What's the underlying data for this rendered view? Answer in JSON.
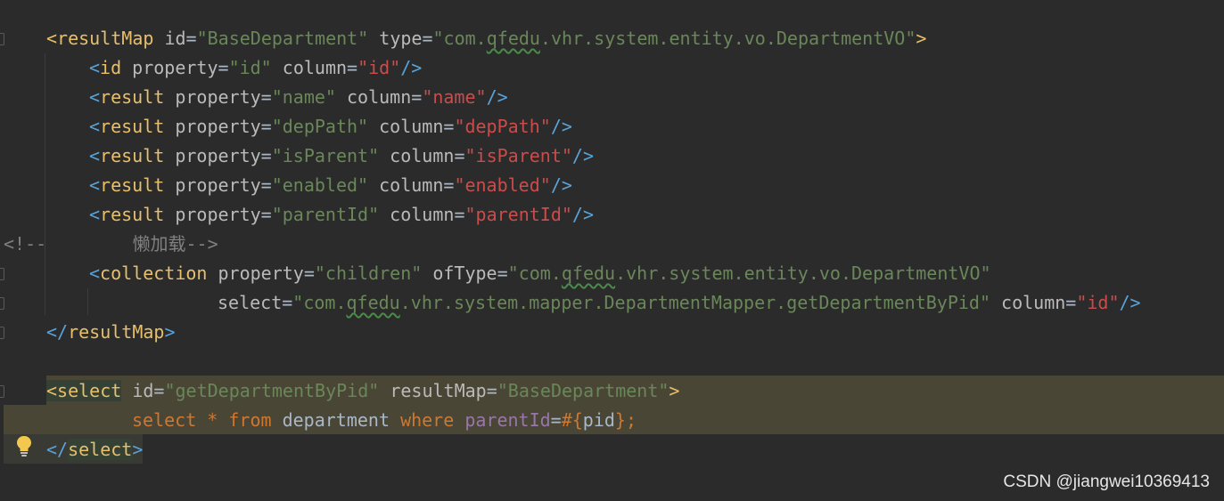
{
  "editor": {
    "lines": [
      {
        "id": "l1",
        "parts": [
          [
            "c-tag",
            "<"
          ],
          [
            "c-tag",
            "resultMap"
          ],
          [
            "c-attr",
            " id"
          ],
          [
            "c-txt",
            "="
          ],
          [
            "c-str",
            "\"BaseDepartment\""
          ],
          [
            "c-attr",
            " type"
          ],
          [
            "c-txt",
            "="
          ],
          [
            "c-str",
            "\"com."
          ],
          [
            "c-str squig",
            "qfedu"
          ],
          [
            "c-str",
            ".vhr.system.entity.vo.DepartmentVO\""
          ],
          [
            "c-tag",
            ">"
          ]
        ]
      },
      {
        "id": "l2",
        "parts": [
          [
            "c-brk",
            "<"
          ],
          [
            "c-tag",
            "id"
          ],
          [
            "c-attr",
            " property"
          ],
          [
            "c-txt",
            "="
          ],
          [
            "c-str",
            "\"id\""
          ],
          [
            "c-attr",
            " column"
          ],
          [
            "c-txt",
            "="
          ],
          [
            "c-col",
            "\"id\""
          ],
          [
            "c-brk",
            "/>"
          ]
        ]
      },
      {
        "id": "l3",
        "parts": [
          [
            "c-brk",
            "<"
          ],
          [
            "c-tag",
            "result"
          ],
          [
            "c-attr",
            " property"
          ],
          [
            "c-txt",
            "="
          ],
          [
            "c-str",
            "\"name\""
          ],
          [
            "c-attr",
            " column"
          ],
          [
            "c-txt",
            "="
          ],
          [
            "c-col",
            "\"name\""
          ],
          [
            "c-brk",
            "/>"
          ]
        ]
      },
      {
        "id": "l4",
        "parts": [
          [
            "c-brk",
            "<"
          ],
          [
            "c-tag",
            "result"
          ],
          [
            "c-attr",
            " property"
          ],
          [
            "c-txt",
            "="
          ],
          [
            "c-str",
            "\"depPath\""
          ],
          [
            "c-attr",
            " column"
          ],
          [
            "c-txt",
            "="
          ],
          [
            "c-col",
            "\"depPath\""
          ],
          [
            "c-brk",
            "/>"
          ]
        ]
      },
      {
        "id": "l5",
        "parts": [
          [
            "c-brk",
            "<"
          ],
          [
            "c-tag",
            "result"
          ],
          [
            "c-attr",
            " property"
          ],
          [
            "c-txt",
            "="
          ],
          [
            "c-str",
            "\"isParent\""
          ],
          [
            "c-attr",
            " column"
          ],
          [
            "c-txt",
            "="
          ],
          [
            "c-col",
            "\"isParent\""
          ],
          [
            "c-brk",
            "/>"
          ]
        ]
      },
      {
        "id": "l6",
        "parts": [
          [
            "c-brk",
            "<"
          ],
          [
            "c-tag",
            "result"
          ],
          [
            "c-attr",
            " property"
          ],
          [
            "c-txt",
            "="
          ],
          [
            "c-str",
            "\"enabled\""
          ],
          [
            "c-attr",
            " column"
          ],
          [
            "c-txt",
            "="
          ],
          [
            "c-col",
            "\"enabled\""
          ],
          [
            "c-brk",
            "/>"
          ]
        ]
      },
      {
        "id": "l7",
        "parts": [
          [
            "c-brk",
            "<"
          ],
          [
            "c-tag",
            "result"
          ],
          [
            "c-attr",
            " property"
          ],
          [
            "c-txt",
            "="
          ],
          [
            "c-str",
            "\"parentId\""
          ],
          [
            "c-attr",
            " column"
          ],
          [
            "c-txt",
            "="
          ],
          [
            "c-col",
            "\"parentId\""
          ],
          [
            "c-brk",
            "/>"
          ]
        ]
      },
      {
        "id": "l8",
        "parts": [
          [
            "c-com",
            "<!--        懒加载-->"
          ]
        ]
      },
      {
        "id": "l9",
        "parts": [
          [
            "c-brk",
            "<"
          ],
          [
            "c-tag",
            "collection"
          ],
          [
            "c-attr",
            " property"
          ],
          [
            "c-txt",
            "="
          ],
          [
            "c-str",
            "\"children\""
          ],
          [
            "c-attr",
            " ofType"
          ],
          [
            "c-txt",
            "="
          ],
          [
            "c-str",
            "\"com."
          ],
          [
            "c-str squig",
            "qfedu"
          ],
          [
            "c-str",
            ".vhr.system.entity.vo.DepartmentVO\""
          ]
        ]
      },
      {
        "id": "l10",
        "parts": [
          [
            "c-attr",
            "select"
          ],
          [
            "c-txt",
            "="
          ],
          [
            "c-str",
            "\"com."
          ],
          [
            "c-str squig",
            "qfedu"
          ],
          [
            "c-str",
            ".vhr.system.mapper.DepartmentMapper.getDepartmentByPid\""
          ],
          [
            "c-attr",
            " column"
          ],
          [
            "c-txt",
            "="
          ],
          [
            "c-col",
            "\"id\""
          ],
          [
            "c-brk",
            "/>"
          ]
        ]
      },
      {
        "id": "l11",
        "parts": [
          [
            "c-brk",
            "</"
          ],
          [
            "c-tag",
            "resultMap"
          ],
          [
            "c-brk",
            ">"
          ]
        ]
      },
      {
        "id": "l12",
        "parts": []
      },
      {
        "id": "l13",
        "parts": [
          [
            "c-tag c-tagmatch",
            "<select"
          ],
          [
            "c-attr",
            " id"
          ],
          [
            "c-txt",
            "="
          ],
          [
            "c-str",
            "\"getDepartmentByPid\""
          ],
          [
            "c-attr",
            " resultMap"
          ],
          [
            "c-txt",
            "="
          ],
          [
            "c-str",
            "\"BaseDepartment\""
          ],
          [
            "c-tag",
            ">"
          ]
        ]
      },
      {
        "id": "l14",
        "parts": [
          [
            "c-kw",
            "select"
          ],
          [
            "c-txt",
            " "
          ],
          [
            "c-kw",
            "*"
          ],
          [
            "c-txt",
            " "
          ],
          [
            "c-kw",
            "from"
          ],
          [
            "c-txt",
            " department "
          ],
          [
            "c-kw",
            "where"
          ],
          [
            "c-txt",
            " "
          ],
          [
            "c-var",
            "parentId"
          ],
          [
            "c-txt",
            "="
          ],
          [
            "c-kw",
            "#{"
          ],
          [
            "c-txt",
            "pid"
          ],
          [
            "c-kw",
            "};"
          ]
        ]
      },
      {
        "id": "l15",
        "parts": [
          [
            "c-brk",
            "</"
          ],
          [
            "c-tag c-tagmatch",
            "select"
          ],
          [
            "c-brk",
            ">"
          ]
        ]
      }
    ]
  },
  "watermark": "CSDN @jiangwei10369413",
  "icons": {
    "hint": "lightbulb-icon"
  },
  "colors": {
    "background": "#2b2b2b",
    "highlight": "#4a4636",
    "tag": "#e8bf6a",
    "string": "#6a8759",
    "column_value": "#cc4b4b",
    "keyword": "#cc7832"
  }
}
